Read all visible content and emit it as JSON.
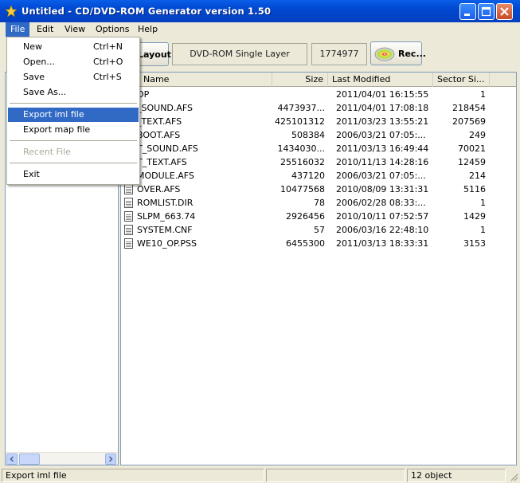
{
  "window": {
    "title": "Untitled - CD/DVD-ROM Generator version 1.50"
  },
  "menubar": [
    {
      "label": "File"
    },
    {
      "label": "Edit"
    },
    {
      "label": "View"
    },
    {
      "label": "Options"
    },
    {
      "label": "Help"
    }
  ],
  "toolbar": {
    "layout_label": "Layout",
    "disc_type": "DVD-ROM Single Layer",
    "sector_total": "1774977",
    "record_label": "Rec..."
  },
  "file_menu": {
    "items": [
      {
        "label": "New",
        "shortcut": "Ctrl+N"
      },
      {
        "label": "Open...",
        "shortcut": "Ctrl+O"
      },
      {
        "label": "Save",
        "shortcut": "Ctrl+S"
      },
      {
        "label": "Save As...",
        "shortcut": ""
      },
      {
        "label": "Export iml file",
        "shortcut": ""
      },
      {
        "label": "Export map file",
        "shortcut": ""
      },
      {
        "label": "Recent File",
        "shortcut": ""
      },
      {
        "label": "Exit",
        "shortcut": ""
      }
    ]
  },
  "file_list": {
    "columns": [
      "Name",
      "Size",
      "Last Modified",
      "Sector Si..."
    ],
    "rows": [
      {
        "name": "OP",
        "size": "",
        "modified": "2011/04/01 16:15:55",
        "sector": "1"
      },
      {
        "name": "_SOUND.AFS",
        "size": "4473937...",
        "modified": "2011/04/01 17:08:18",
        "sector": "218454"
      },
      {
        "name": "_TEXT.AFS",
        "size": "425101312",
        "modified": "2011/03/23 13:55:21",
        "sector": "207569"
      },
      {
        "name": "BOOT.AFS",
        "size": "508384",
        "modified": "2006/03/21 07:05:...",
        "sector": "249"
      },
      {
        "name": "T_SOUND.AFS",
        "size": "1434030...",
        "modified": "2011/03/13 16:49:44",
        "sector": "70021"
      },
      {
        "name": "T_TEXT.AFS",
        "size": "25516032",
        "modified": "2010/11/13 14:28:16",
        "sector": "12459"
      },
      {
        "name": "MODULE.AFS",
        "size": "437120",
        "modified": "2006/03/21 07:05:...",
        "sector": "214"
      },
      {
        "name": "OVER.AFS",
        "size": "10477568",
        "modified": "2010/08/09 13:31:31",
        "sector": "5116"
      },
      {
        "name": "ROMLIST.DIR",
        "size": "78",
        "modified": "2006/02/28 08:33:...",
        "sector": "1"
      },
      {
        "name": "SLPM_663.74",
        "size": "2926456",
        "modified": "2010/10/11 07:52:57",
        "sector": "1429"
      },
      {
        "name": "SYSTEM.CNF",
        "size": "57",
        "modified": "2006/03/16 22:48:10",
        "sector": "1"
      },
      {
        "name": "WE10_OP.PSS",
        "size": "6455300",
        "modified": "2011/03/13 18:33:31",
        "sector": "3153"
      }
    ]
  },
  "statusbar": {
    "message": "Export iml file",
    "count": "12 object"
  }
}
